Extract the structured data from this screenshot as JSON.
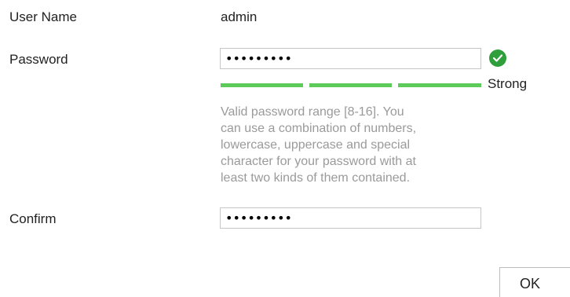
{
  "form": {
    "username_label": "User Name",
    "username_value": "admin",
    "password_label": "Password",
    "password_value": "•••••••••",
    "confirm_label": "Confirm",
    "confirm_value": "•••••••••"
  },
  "strength": {
    "level": 3,
    "max_level": 3,
    "label": "Strong",
    "color": "#5ccb5a"
  },
  "hint": {
    "text": "Valid password range [8-16]. You\ncan use a combination of numbers,\nlowercase, uppercase and special\ncharacter for your password with at\nleast two kinds of them contained."
  },
  "buttons": {
    "ok_label": "OK"
  },
  "icons": {
    "valid": "check-circle-icon"
  },
  "colors": {
    "valid_green": "#2e9f3a",
    "hint_gray": "#9a9a9a"
  }
}
